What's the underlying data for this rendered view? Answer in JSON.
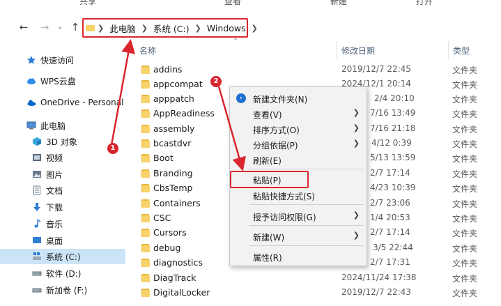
{
  "top_strip": [
    "共享",
    "查看",
    "新建",
    "打开"
  ],
  "address": {
    "crumbs": [
      "此电脑",
      "系统 (C:)",
      "Windows"
    ]
  },
  "columns": {
    "name": "名称",
    "date": "修改日期",
    "type": "类型"
  },
  "sidebar": {
    "items": [
      {
        "label": "快速访问",
        "icon": "star-icon"
      },
      {
        "label": "WPS云盘",
        "icon": "cloud-icon"
      },
      {
        "label": "OneDrive - Personal",
        "icon": "onedrive-icon"
      },
      {
        "label": "此电脑",
        "icon": "computer-icon"
      },
      {
        "label": "3D 对象",
        "icon": "cube-icon"
      },
      {
        "label": "视频",
        "icon": "video-icon"
      },
      {
        "label": "图片",
        "icon": "picture-icon"
      },
      {
        "label": "文档",
        "icon": "document-icon"
      },
      {
        "label": "下载",
        "icon": "download-icon"
      },
      {
        "label": "音乐",
        "icon": "music-icon"
      },
      {
        "label": "桌面",
        "icon": "desktop-icon"
      },
      {
        "label": "系统 (C:)",
        "icon": "drive-c-icon"
      },
      {
        "label": "软件 (D:)",
        "icon": "drive-icon"
      },
      {
        "label": "新加卷 (F:)",
        "icon": "drive-icon"
      }
    ]
  },
  "files": [
    {
      "name": "addins",
      "date": "2019/12/7 22:45",
      "type": "文件夹"
    },
    {
      "name": "appcompat",
      "date": "2024/12/1 20:14",
      "type": "文件夹"
    },
    {
      "name": "apppatch",
      "date": "2/4 20:10",
      "type": "文件夹"
    },
    {
      "name": "AppReadiness",
      "date": "7/16 13:49",
      "type": "文件夹"
    },
    {
      "name": "assembly",
      "date": "7/16 21:18",
      "type": "文件夹"
    },
    {
      "name": "bcastdvr",
      "date": "4/12 0:39",
      "type": "文件夹"
    },
    {
      "name": "Boot",
      "date": "5/13 13:59",
      "type": "文件夹"
    },
    {
      "name": "Branding",
      "date": "2/7 17:14",
      "type": "文件夹"
    },
    {
      "name": "CbsTemp",
      "date": "4/23 10:39",
      "type": "文件夹"
    },
    {
      "name": "Containers",
      "date": "2/7 23:06",
      "type": "文件夹"
    },
    {
      "name": "CSC",
      "date": "1/4 20:53",
      "type": "文件夹"
    },
    {
      "name": "Cursors",
      "date": "2/7 17:14",
      "type": "文件夹"
    },
    {
      "name": "debug",
      "date": "3/5 22:44",
      "type": "文件夹"
    },
    {
      "name": "diagnostics",
      "date": "2/7 17:31",
      "type": "文件夹"
    },
    {
      "name": "DiagTrack",
      "date": "2024/11/24 17:38",
      "type": "文件夹"
    },
    {
      "name": "DigitalLocker",
      "date": "2019/12/7 22:43",
      "type": "文件夹"
    }
  ],
  "context_menu": {
    "items": [
      {
        "label": "新建文件夹(N)",
        "has_icon": true
      },
      {
        "label": "查看(V)",
        "submenu": true
      },
      {
        "label": "排序方式(O)",
        "submenu": true
      },
      {
        "label": "分组依据(P)",
        "submenu": true
      },
      {
        "label": "刷新(E)"
      },
      {
        "label": "粘贴(P)"
      },
      {
        "label": "粘贴快捷方式(S)"
      },
      {
        "label": "授予访问权限(G)",
        "submenu": true
      },
      {
        "label": "新建(W)",
        "submenu": true
      },
      {
        "label": "属性(R)"
      }
    ]
  },
  "annotations": {
    "step1": "1",
    "step2": "2"
  },
  "colors": {
    "highlight_red": "#d9262f",
    "selected_bg": "#cce4f7",
    "folder": "#f8d26a"
  }
}
